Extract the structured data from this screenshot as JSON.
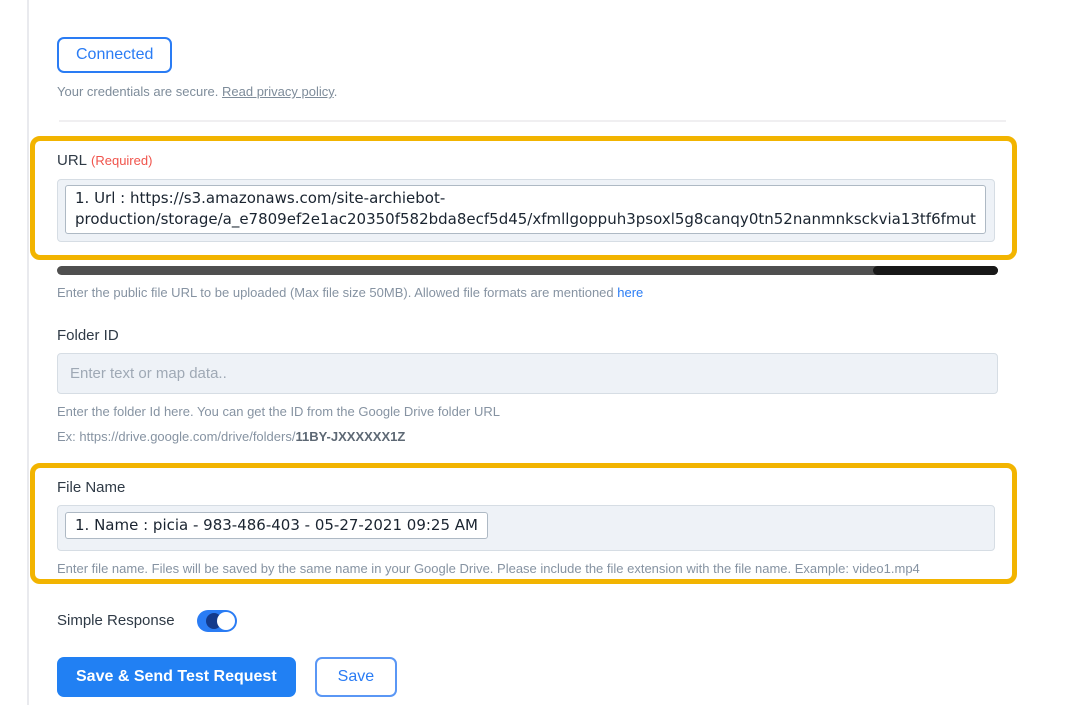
{
  "colors": {
    "accent_blue": "#2a7cf4",
    "highlight_orange": "#f2b400",
    "required_red": "#f0544c",
    "input_bg": "#eef2f7"
  },
  "connection": {
    "status_button": "Connected",
    "secure_text": "Your credentials are secure. ",
    "privacy_link": "Read privacy policy",
    "suffix": "."
  },
  "url_field": {
    "label": "URL",
    "required": "(Required)",
    "value_line1": "1. Url : https://s3.amazonaws.com/site-archiebot-",
    "value_line2": "production/storage/a_e7809ef2e1ac20350f582bda8ecf5d45/xfmllgoppuh3psoxl5g8canqy0tn52nanmnksckvia13tf6fmut",
    "helper_text": "Enter the public file URL to be uploaded (Max file size 50MB). Allowed file formats are mentioned ",
    "helper_link": "here"
  },
  "folder_field": {
    "label": "Folder ID",
    "placeholder": "Enter text or map data..",
    "helper_text": "Enter the folder Id here. You can get the ID from the Google Drive folder URL",
    "example_prefix": "Ex: https://drive.google.com/drive/folders/",
    "example_folder_id": "11BY-JXXXXXX1Z"
  },
  "file_name_field": {
    "label": "File Name",
    "value": "1. Name : picia - 983-486-403 - 05-27-2021 09:25 AM",
    "helper_text": "Enter file name. Files will be saved by the same name in your Google Drive. Please include the file extension with the file name. Example: video1.mp4"
  },
  "simple_response": {
    "label": "Simple Response",
    "state": "on"
  },
  "actions": {
    "save_and_send": "Save & Send Test Request",
    "save": "Save"
  }
}
